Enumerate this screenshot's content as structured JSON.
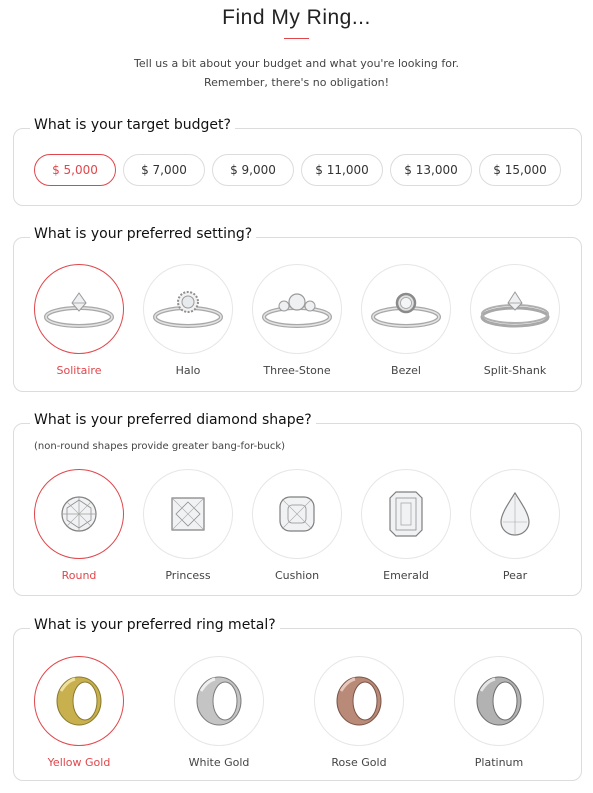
{
  "header": {
    "title": "Find My Ring...",
    "intro_line1": "Tell us a bit about your budget and what you're looking for.",
    "intro_line2": "Remember, there's no obligation!"
  },
  "budget": {
    "question": "What is your target budget?",
    "options": [
      "$ 5,000",
      "$ 7,000",
      "$ 9,000",
      "$ 11,000",
      "$ 13,000",
      "$ 15,000"
    ],
    "selected": "$ 5,000"
  },
  "setting": {
    "question": "What is your preferred setting?",
    "options": [
      "Solitaire",
      "Halo",
      "Three-Stone",
      "Bezel",
      "Split-Shank"
    ],
    "selected": "Solitaire"
  },
  "shape": {
    "question": "What is your preferred diamond shape?",
    "note": "(non-round shapes provide greater bang-for-buck)",
    "options": [
      "Round",
      "Princess",
      "Cushion",
      "Emerald",
      "Pear"
    ],
    "selected": "Round"
  },
  "metal": {
    "question": "What is your preferred ring metal?",
    "options": [
      "Yellow Gold",
      "White Gold",
      "Rose Gold",
      "Platinum"
    ],
    "selected": "Yellow Gold"
  },
  "colors": {
    "accent": "#e0474c",
    "border": "#dcdcdc",
    "yellow_gold": "#c9b04f",
    "white_gold": "#c4c4c4",
    "rose_gold": "#b98a78",
    "platinum": "#b2b2b2"
  }
}
